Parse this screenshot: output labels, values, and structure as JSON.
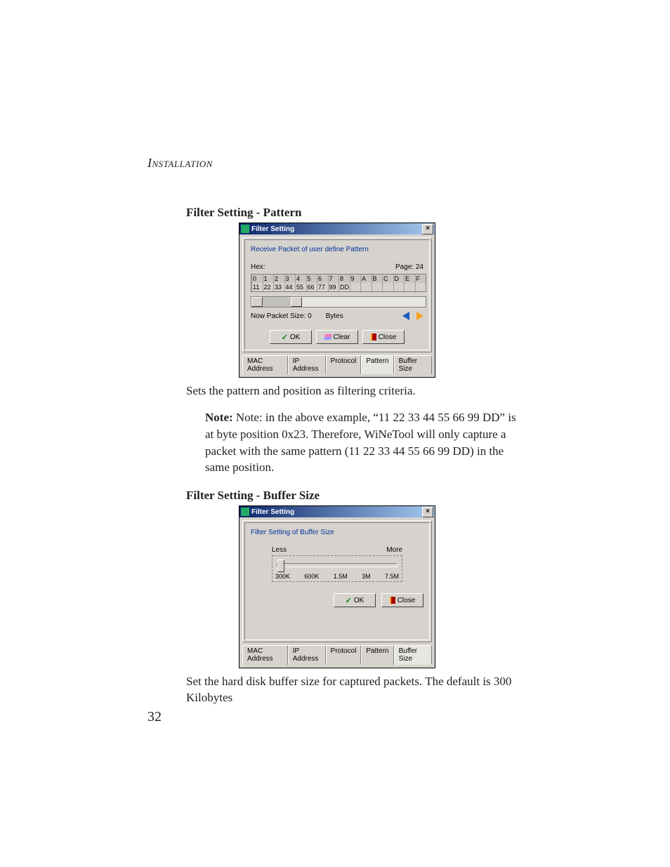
{
  "running_head": "INSTALLATION",
  "page_number": "32",
  "sec1": {
    "title": "Filter Setting - Pattern",
    "body": "Sets the pattern and position as filtering criteria.",
    "note_label": "Note:",
    "note_text": " Note: in the above example, “11 22 33 44 55 66 99 DD” is at byte position 0x23. Therefore, WiNeTool will only capture a packet with the same pattern (11 22 33 44 55 66 99 DD) in the same position."
  },
  "dlg1": {
    "title": "Filter Setting",
    "panel_caption": "Receive Packet of user define Pattern",
    "hex_label": "Hex:",
    "page_label": "Page: 24",
    "cols": [
      "0",
      "1",
      "2",
      "3",
      "4",
      "5",
      "6",
      "7",
      "8",
      "9",
      "A",
      "B",
      "C",
      "D",
      "E",
      "F"
    ],
    "vals": [
      "11",
      "22",
      "33",
      "44",
      "55",
      "66",
      "77",
      "99",
      "DD",
      "",
      "",
      "",
      "",
      "",
      "",
      ""
    ],
    "packet_size_label": "Now Packet Size: 0",
    "bytes_label": "Bytes",
    "ok": "OK",
    "clear": "Clear",
    "close": "Close",
    "tabs": [
      "MAC Address",
      "IP Address",
      "Protocol",
      "Pattern",
      "Buffer Size"
    ],
    "active_tab": 3
  },
  "sec2": {
    "title": "Filter Setting - Buffer Size",
    "body": "Set the hard disk buffer size for captured packets. The default is 300 Kilobytes"
  },
  "dlg2": {
    "title": "Filter Setting",
    "panel_caption": "Filter Setting of Buffer Size",
    "less": "Less",
    "more": "More",
    "ticks": [
      "300K",
      "600K",
      "1.5M",
      "3M",
      "7.5M"
    ],
    "ok": "OK",
    "close": "Close",
    "tabs": [
      "MAC Address",
      "IP Address",
      "Protocol",
      "Pattern",
      "Buffer Size"
    ],
    "active_tab": 4
  }
}
